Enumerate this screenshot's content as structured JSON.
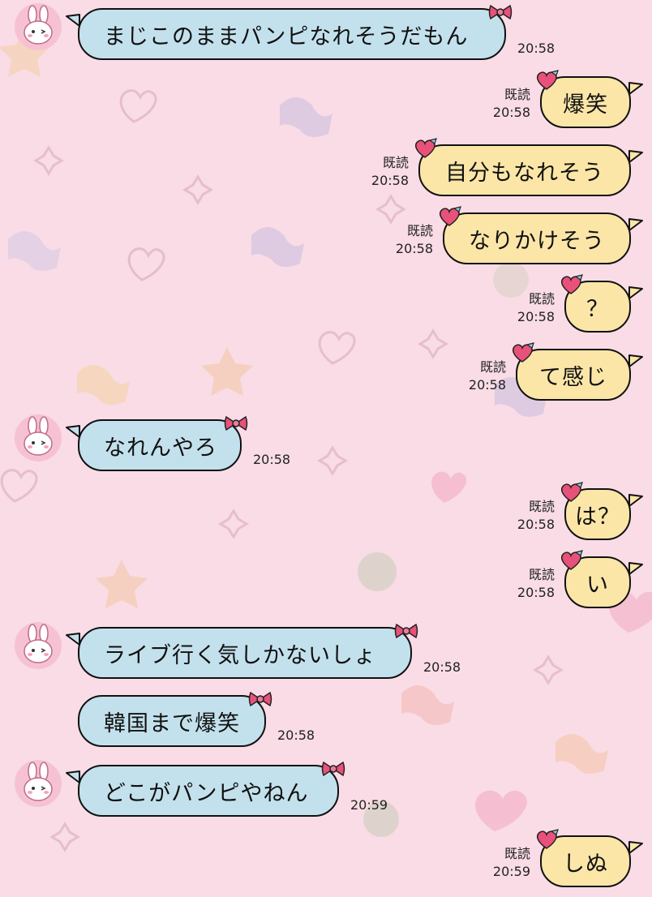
{
  "colors": {
    "background": "#f9dce5",
    "incoming_bubble": "#c3e1ec",
    "outgoing_bubble": "#fbe6a8",
    "bubble_border": "#111111",
    "bow_ribbon": "#e8517a",
    "avatar": "#f6c2d3"
  },
  "read_label": "既読",
  "messages": [
    {
      "dir": "in",
      "text": "まじこのままパンピなれそうだもん",
      "time": "20:58",
      "avatar": true
    },
    {
      "dir": "out",
      "text": "爆笑",
      "time": "20:58",
      "read": true
    },
    {
      "dir": "out",
      "text": "自分もなれそう",
      "time": "20:58",
      "read": true
    },
    {
      "dir": "out",
      "text": "なりかけそう",
      "time": "20:58",
      "read": true
    },
    {
      "dir": "out",
      "text": "？",
      "time": "20:58",
      "read": true
    },
    {
      "dir": "out",
      "text": "て感じ",
      "time": "20:58",
      "read": true
    },
    {
      "dir": "in",
      "text": "なれんやろ",
      "time": "20:58",
      "avatar": true
    },
    {
      "dir": "out",
      "text": "は？",
      "time": "20:58",
      "read": true
    },
    {
      "dir": "out",
      "text": "い",
      "time": "20:58",
      "read": true
    },
    {
      "dir": "in",
      "text": "ライブ行く気しかないしょ",
      "time": "20:58",
      "avatar": true
    },
    {
      "dir": "in",
      "text": "韓国まで爆笑",
      "time": "20:58",
      "avatar": false
    },
    {
      "dir": "in",
      "text": "どこがパンピやねん",
      "time": "20:59",
      "avatar": true
    },
    {
      "dir": "out",
      "text": "しぬ",
      "time": "20:59",
      "read": true
    }
  ]
}
